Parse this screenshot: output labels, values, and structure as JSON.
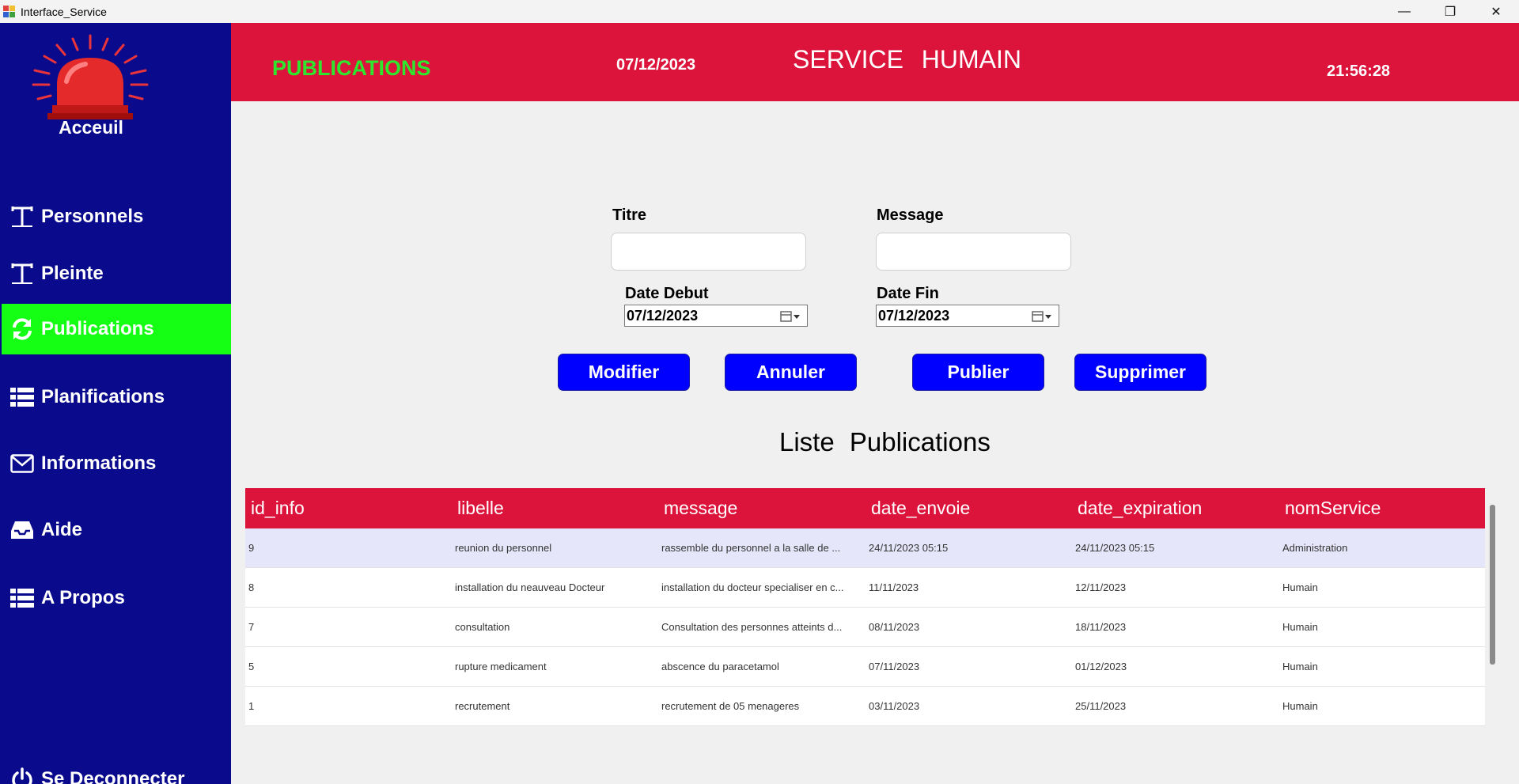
{
  "window": {
    "title": "Interface_Service"
  },
  "sidebar": {
    "home_label": "Acceuil",
    "items": [
      {
        "label": "Personnels",
        "icon": "text-tool-icon"
      },
      {
        "label": "Pleinte",
        "icon": "text-tool-icon"
      },
      {
        "label": "Publications",
        "icon": "refresh-icon",
        "active": true
      },
      {
        "label": "Planifications",
        "icon": "list-icon"
      },
      {
        "label": "Informations",
        "icon": "mail-icon"
      },
      {
        "label": "Aide",
        "icon": "inbox-icon"
      },
      {
        "label": "A Propos",
        "icon": "list-icon"
      },
      {
        "label": "Se Deconnecter",
        "icon": "power-icon"
      }
    ]
  },
  "header": {
    "section": "PUBLICATIONS",
    "date": "07/12/2023",
    "service": "SERVICE   HUMAIN",
    "time": "21:56:28"
  },
  "form": {
    "titre_label": "Titre",
    "message_label": "Message",
    "date_debut_label": "Date Debut",
    "date_fin_label": "Date Fin",
    "date_debut_value": "07/12/2023",
    "date_fin_value": "07/12/2023",
    "buttons": {
      "modifier": "Modifier",
      "annuler": "Annuler",
      "publier": "Publier",
      "supprimer": "Supprimer"
    }
  },
  "list": {
    "title": "Liste  Publications",
    "columns": [
      "id_info",
      "libelle",
      "message",
      "date_envoie",
      "date_expiration",
      "nomService"
    ],
    "rows": [
      [
        "9",
        "reunion  du personnel",
        "rassemble du personnel a la salle de ...",
        "24/11/2023 05:15",
        "24/11/2023 05:15",
        "Administration"
      ],
      [
        "8",
        "installation du neauveau Docteur",
        "installation du docteur specialiser en c...",
        "11/11/2023",
        "12/11/2023",
        "Humain"
      ],
      [
        "7",
        "consultation",
        "Consultation des personnes atteints d...",
        "08/11/2023",
        "18/11/2023",
        "Humain"
      ],
      [
        "5",
        "rupture medicament",
        "abscence du paracetamol",
        "07/11/2023",
        "01/12/2023",
        "Humain"
      ],
      [
        "1",
        "recrutement",
        "recrutement de 05 menageres",
        "03/11/2023",
        "25/11/2023",
        "Humain"
      ]
    ]
  },
  "colors": {
    "sidebar": "#0a0a8c",
    "header": "#dc143c",
    "active": "#14ff14",
    "button": "#0000ff"
  }
}
